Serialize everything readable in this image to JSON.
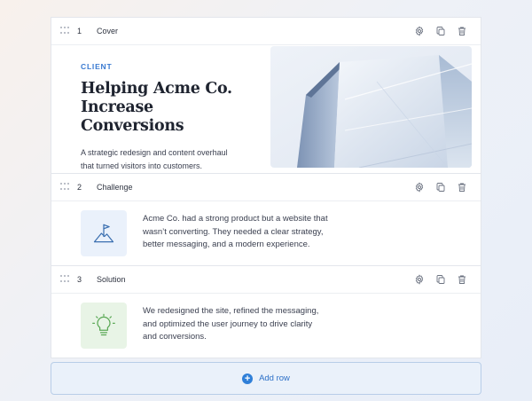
{
  "blocks": [
    {
      "number": "1",
      "title": "Cover",
      "eyebrow": "CLIENT",
      "headline_line1": "Helping Acme Co.",
      "headline_line2": "Increase Conversions",
      "description_line1": "A strategic redesign and content overhaul",
      "description_line2": "that turned visitors into customers."
    },
    {
      "number": "2",
      "title": "Challenge",
      "text_line1": "Acme Co. had a strong product but a website that",
      "text_line2": "wasn’t converting. They needed a clear strategy,",
      "text_line3": "better messaging, and a modern experience."
    },
    {
      "number": "3",
      "title": "Solution",
      "text_line1": "We redesigned the site, refined the messaging,",
      "text_line2": "and optimized the user journey to drive clarity",
      "text_line3": "and conversions."
    }
  ],
  "add_row_label": "Add row",
  "colors": {
    "accent": "#2f7fd8",
    "eyebrow": "#3a7ad1",
    "challenge_tile": "#eaf1fb",
    "solution_tile": "#e8f4e6",
    "solution_icon": "#5aa855"
  },
  "icons": [
    "drag-handle-icon",
    "gear-icon",
    "duplicate-icon",
    "trash-icon",
    "flag-mountain-icon",
    "lightbulb-icon",
    "plus-circle-icon"
  ]
}
